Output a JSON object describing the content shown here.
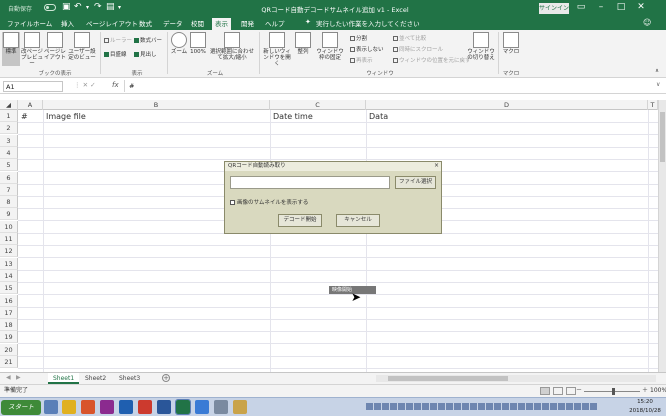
{
  "titlebar": {
    "autosave_label": "自動保存",
    "autosave_state": "オフ",
    "title": "QRコード自動デコードサムネイル追加 v1 - Excel",
    "signin_label": "サインイン"
  },
  "tabs": [
    "ファイル",
    "ホーム",
    "挿入",
    "ページレイアウト",
    "数式",
    "データ",
    "校閲",
    "表示",
    "開発",
    "ヘルプ"
  ],
  "active_tab": "表示",
  "search_text": "実行したい作業を入力してください",
  "ribbon": {
    "normal": "標準",
    "page_break": "改ページプレビュー",
    "page_layout": "ページレイアウト",
    "custom_views": "ユーザー設定のビュー",
    "group_views": "ブックの表示",
    "ruler": "ルーラー",
    "formula_bar": "数式バー",
    "gridlines": "目盛線",
    "headings": "見出し",
    "group_show": "表示",
    "zoom": "ズーム",
    "zoom100": "100%",
    "zoom_selection": "選択範囲に合わせて拡大/縮小",
    "group_zoom": "ズーム",
    "new_window": "新しいウィンドウを開く",
    "arrange_all": "整列",
    "freeze_panes": "ウィンドウ枠の固定",
    "split": "分割",
    "hide": "表示しない",
    "unhide": "再表示",
    "view_side_by_side": "並べて比較",
    "sync_scroll": "同時にスクロール",
    "reset_window": "ウィンドウの位置を元に戻す",
    "switch_windows": "ウィンドウの切り替え",
    "group_window": "ウィンドウ",
    "macros": "マクロ",
    "group_macros": "マクロ"
  },
  "formula_bar": {
    "name_box": "A1",
    "fx": "fx",
    "content": "#"
  },
  "columns": [
    {
      "id": "row",
      "label": ""
    },
    {
      "id": "A",
      "label": "A"
    },
    {
      "id": "B",
      "label": "B"
    },
    {
      "id": "C",
      "label": "C"
    },
    {
      "id": "D",
      "label": "D"
    },
    {
      "id": "T",
      "label": "T"
    }
  ],
  "rows": [
    "1",
    "2",
    "3",
    "4",
    "5",
    "6",
    "7",
    "8",
    "9",
    "10",
    "11",
    "12",
    "13",
    "14",
    "15",
    "16",
    "17",
    "18",
    "19",
    "20",
    "21"
  ],
  "cells": {
    "A1": "#",
    "B1": "Image file",
    "C1": "Date time",
    "D1": "Data"
  },
  "dialog": {
    "title": "QRコード自動読み取り",
    "close": "×",
    "browse_button": "ファイル選択",
    "checkbox_label": "画像のサムネイルを表示する",
    "decode_button": "デコード開始",
    "cancel_button": "キャンセル"
  },
  "tooltip": "映像開始",
  "sheet_tabs": [
    "Sheet1",
    "Sheet2",
    "Sheet3"
  ],
  "active_sheet": "Sheet1",
  "status": {
    "ready": "準備完了",
    "zoom_minus": "－",
    "zoom_plus": "＋",
    "zoom_pct": "100%"
  },
  "taskbar": {
    "start_label": "スタート",
    "time": "15:20",
    "date": "2018/10/28"
  },
  "colors": {
    "excel_green": "#217346",
    "ribbon_bg": "#f3f3f3",
    "dialog_bg": "#d9d9bf",
    "taskbar_bg": "#c7d3e6"
  }
}
